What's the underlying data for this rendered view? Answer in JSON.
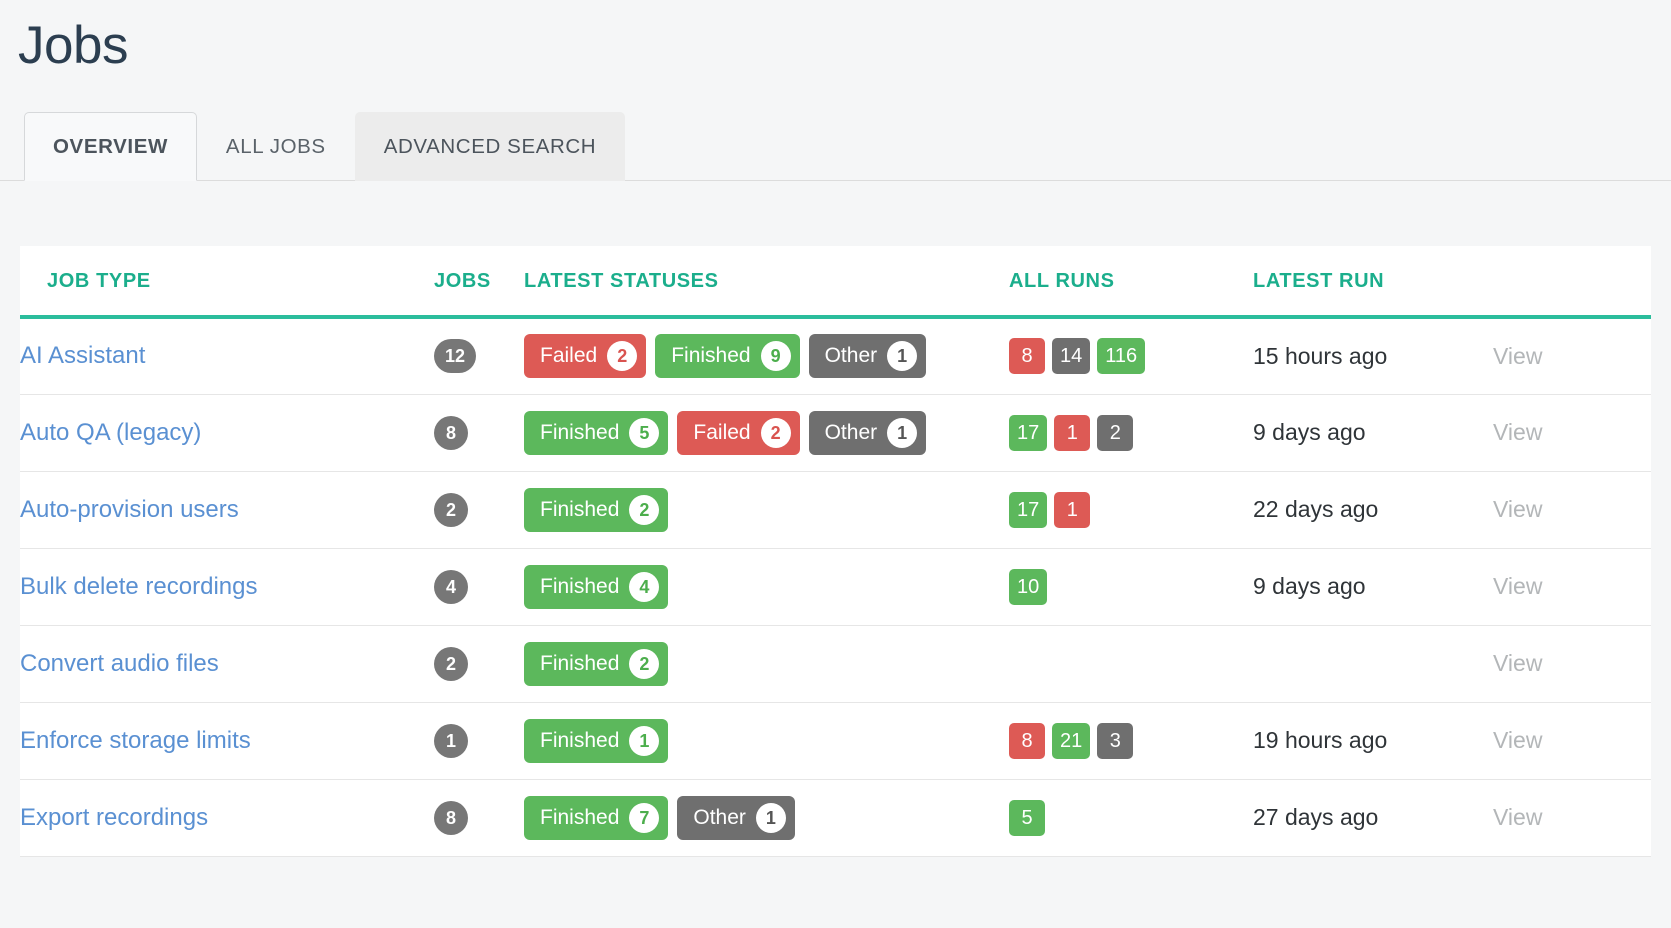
{
  "page": {
    "title": "Jobs",
    "accent_teal": "#2bbd9c",
    "header_text_color": "#1bae8c",
    "link_blue": "#5a90d2",
    "background": "#f5f6f7"
  },
  "tabs": [
    {
      "label": "OVERVIEW",
      "state": "active"
    },
    {
      "label": "ALL JOBS",
      "state": "default"
    },
    {
      "label": "ADVANCED SEARCH",
      "state": "hovered"
    }
  ],
  "table": {
    "columns": [
      {
        "key": "jobtype",
        "label": "JOB TYPE"
      },
      {
        "key": "jobs",
        "label": "JOBS"
      },
      {
        "key": "statuses",
        "label": "LATEST STATUSES"
      },
      {
        "key": "allruns",
        "label": "ALL RUNS"
      },
      {
        "key": "latestrun",
        "label": "LATEST RUN"
      },
      {
        "key": "action",
        "label": ""
      }
    ],
    "action_label": "View",
    "rows": [
      {
        "jobtype": "AI Assistant",
        "jobs": "12",
        "statuses": [
          {
            "label": "Failed",
            "count": "2",
            "color": "red"
          },
          {
            "label": "Finished",
            "count": "9",
            "color": "green"
          },
          {
            "label": "Other",
            "count": "1",
            "color": "gray"
          }
        ],
        "allruns": [
          {
            "count": "8",
            "color": "red"
          },
          {
            "count": "14",
            "color": "gray"
          },
          {
            "count": "116",
            "color": "green"
          }
        ],
        "latestrun": "15 hours ago",
        "action": "View"
      },
      {
        "jobtype": "Auto QA (legacy)",
        "jobs": "8",
        "statuses": [
          {
            "label": "Finished",
            "count": "5",
            "color": "green"
          },
          {
            "label": "Failed",
            "count": "2",
            "color": "red"
          },
          {
            "label": "Other",
            "count": "1",
            "color": "gray"
          }
        ],
        "allruns": [
          {
            "count": "17",
            "color": "green"
          },
          {
            "count": "1",
            "color": "red"
          },
          {
            "count": "2",
            "color": "gray"
          }
        ],
        "latestrun": "9 days ago",
        "action": "View"
      },
      {
        "jobtype": "Auto-provision users",
        "jobs": "2",
        "statuses": [
          {
            "label": "Finished",
            "count": "2",
            "color": "green"
          }
        ],
        "allruns": [
          {
            "count": "17",
            "color": "green"
          },
          {
            "count": "1",
            "color": "red"
          }
        ],
        "latestrun": "22 days ago",
        "action": "View"
      },
      {
        "jobtype": "Bulk delete recordings",
        "jobs": "4",
        "statuses": [
          {
            "label": "Finished",
            "count": "4",
            "color": "green"
          }
        ],
        "allruns": [
          {
            "count": "10",
            "color": "green"
          }
        ],
        "latestrun": "9 days ago",
        "action": "View"
      },
      {
        "jobtype": "Convert audio files",
        "jobs": "2",
        "statuses": [
          {
            "label": "Finished",
            "count": "2",
            "color": "green"
          }
        ],
        "allruns": [],
        "latestrun": "",
        "action": "View"
      },
      {
        "jobtype": "Enforce storage limits",
        "jobs": "1",
        "statuses": [
          {
            "label": "Finished",
            "count": "1",
            "color": "green"
          }
        ],
        "allruns": [
          {
            "count": "8",
            "color": "red"
          },
          {
            "count": "21",
            "color": "green"
          },
          {
            "count": "3",
            "color": "gray"
          }
        ],
        "latestrun": "19 hours ago",
        "action": "View"
      },
      {
        "jobtype": "Export recordings",
        "jobs": "8",
        "statuses": [
          {
            "label": "Finished",
            "count": "7",
            "color": "green"
          },
          {
            "label": "Other",
            "count": "1",
            "color": "gray"
          }
        ],
        "allruns": [
          {
            "count": "5",
            "color": "green"
          }
        ],
        "latestrun": "27 days ago",
        "action": "View"
      }
    ]
  }
}
